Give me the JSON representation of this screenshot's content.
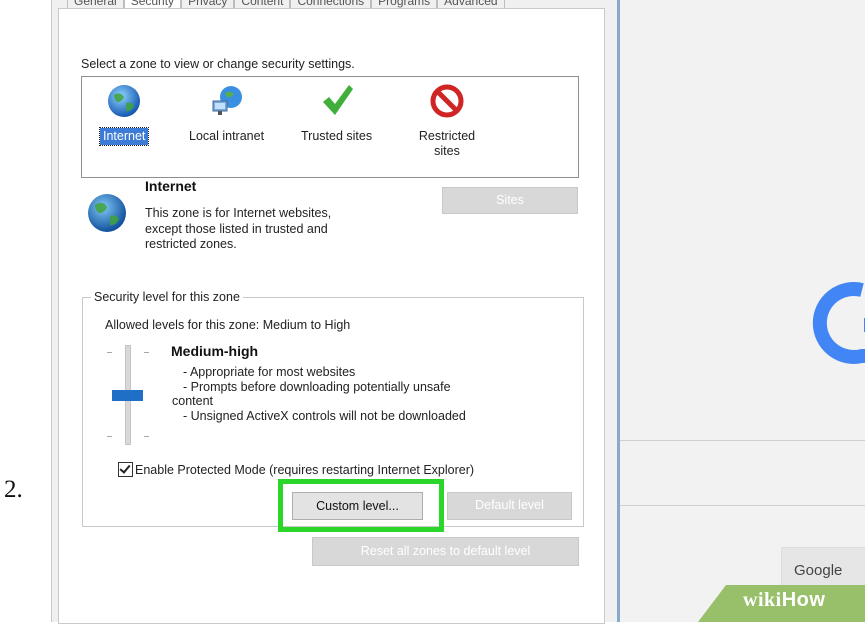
{
  "step_number": "2.",
  "tabs": [
    "General",
    "Security",
    "Privacy",
    "Content",
    "Connections",
    "Programs",
    "Advanced"
  ],
  "zone_prompt": "Select a zone to view or change security settings.",
  "zones": [
    {
      "label": "Internet",
      "icon": "globe-icon",
      "selected": true
    },
    {
      "label": "Local intranet",
      "icon": "intranet-icon",
      "selected": false
    },
    {
      "label": "Trusted sites",
      "icon": "checkmark-icon",
      "selected": false
    },
    {
      "label": "Restricted sites",
      "icon": "restricted-icon",
      "selected": false
    }
  ],
  "zone_info": {
    "title": "Internet",
    "description": "This zone is for Internet websites, except those listed in trusted and restricted zones."
  },
  "sites_button": "Sites",
  "security_group": {
    "title": "Security level for this zone",
    "allowed": "Allowed levels for this zone: Medium to High",
    "level_title": "Medium-high",
    "level_points": [
      "- Appropriate for most websites",
      "- Prompts before downloading potentially unsafe",
      "content",
      "- Unsigned ActiveX controls will not be downloaded"
    ],
    "slider_level": "Medium-high"
  },
  "protected_mode": {
    "label": "Enable Protected Mode (requires restarting Internet Explorer)",
    "checked": true
  },
  "buttons": {
    "custom_level": "Custom level...",
    "default_level": "Default level",
    "reset_all": "Reset all zones to default level"
  },
  "browser": {
    "google_button": "Google",
    "logo_letter": "G"
  },
  "watermark": {
    "wiki": "wiki",
    "how": "How"
  },
  "colors": {
    "highlight": "#2bd62b",
    "selected_zone": "#3d7cd6",
    "slider_thumb": "#1f6fc7",
    "google_blue": "#4285f4",
    "wiki_green": "#98c06a"
  }
}
